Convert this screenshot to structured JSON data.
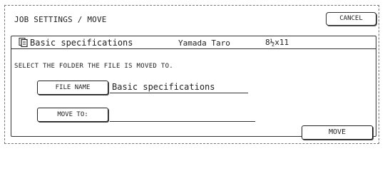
{
  "header": {
    "title": "JOB SETTINGS / MOVE",
    "cancel_label": "CANCEL"
  },
  "file": {
    "name": "Basic specifications",
    "owner": "Yamada Taro",
    "size": "8½x11"
  },
  "instruction": "SELECT THE FOLDER THE FILE IS MOVED TO.",
  "form": {
    "file_name_label": "FILE NAME",
    "file_name_value": "Basic specifications",
    "move_to_label": "MOVE TO:",
    "move_to_value": ""
  },
  "move_label": "MOVE"
}
